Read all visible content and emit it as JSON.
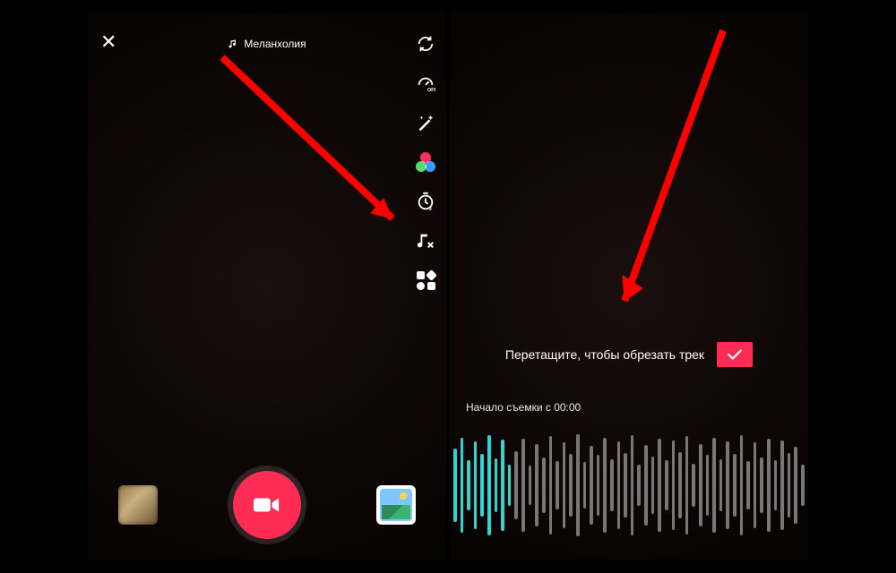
{
  "left": {
    "close_glyph": "✕",
    "sound_label": "Меланхолия",
    "tools": {
      "flip": "flip-camera-icon",
      "speed": "speed-icon",
      "beauty": "magic-wand-icon",
      "filters": "filters-icon",
      "timer": "timer-icon",
      "timer_digit": "3",
      "trim_sound": "trim-sound-icon",
      "templates": "templates-icon",
      "speed_sub": "OFF"
    },
    "bottom": {
      "effects": "effects-thumb",
      "record": "record-button",
      "gallery": "gallery-thumb"
    }
  },
  "right": {
    "trim_hint": "Перетащите, чтобы обрезать трек",
    "start_label": "Начало съемки с 00:00",
    "confirm": "confirm-button"
  },
  "waveform": {
    "active_count": 9,
    "heights": [
      70,
      92,
      48,
      84,
      60,
      96,
      52,
      88,
      40,
      66,
      90,
      38,
      80,
      54,
      94,
      46,
      82,
      60,
      98,
      44,
      76,
      58,
      92,
      50,
      84,
      62,
      96,
      40,
      78,
      56,
      90,
      48,
      86,
      64,
      94,
      42,
      80,
      58,
      92,
      50,
      84,
      60,
      96,
      46,
      82,
      54,
      90,
      48,
      86,
      62,
      74,
      40
    ]
  },
  "colors": {
    "accent": "#fe2c55",
    "arrow": "#ff0000",
    "wave_active": "#35d3d0"
  }
}
